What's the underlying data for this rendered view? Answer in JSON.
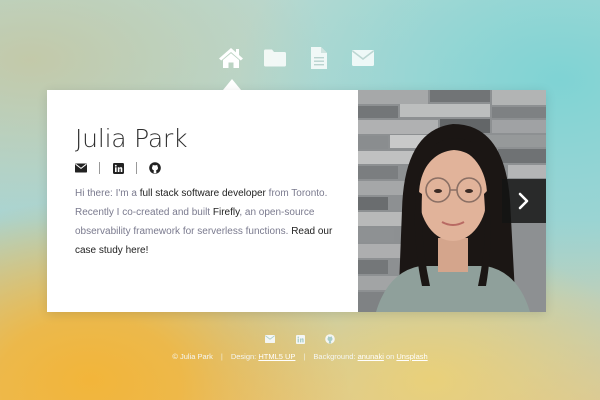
{
  "nav": {
    "items": [
      {
        "icon": "home-icon",
        "active": true
      },
      {
        "icon": "folder-icon",
        "active": false
      },
      {
        "icon": "file-icon",
        "active": false
      },
      {
        "icon": "envelope-icon",
        "active": false
      }
    ]
  },
  "profile": {
    "name": "Julia Park",
    "social_icons": [
      "envelope-icon",
      "linkedin-icon",
      "github-icon"
    ],
    "intro": {
      "prefix": "Hi there: I'm a ",
      "highlight": "full stack software developer",
      "suffix": " from Toronto."
    },
    "recent": {
      "prefix": "Recently I co-created and built ",
      "project": "Firefly",
      "middle": ", an open-source observability framework for serverless functions. ",
      "link": "Read our case study here!"
    }
  },
  "photo": {
    "next_icon": "chevron-right-icon"
  },
  "footer": {
    "icons": [
      "envelope-icon",
      "linkedin-icon",
      "github-icon"
    ],
    "copyright": "© Julia Park",
    "design_label": "Design: ",
    "design_link": "HTML5 UP",
    "background_label": "Background: ",
    "background_author": "anunaki",
    "background_on": " on ",
    "background_site": "Unsplash"
  },
  "colors": {
    "icon_white": "#ffffff",
    "text_dark": "#222222",
    "text_muted": "#7a7a8e"
  }
}
